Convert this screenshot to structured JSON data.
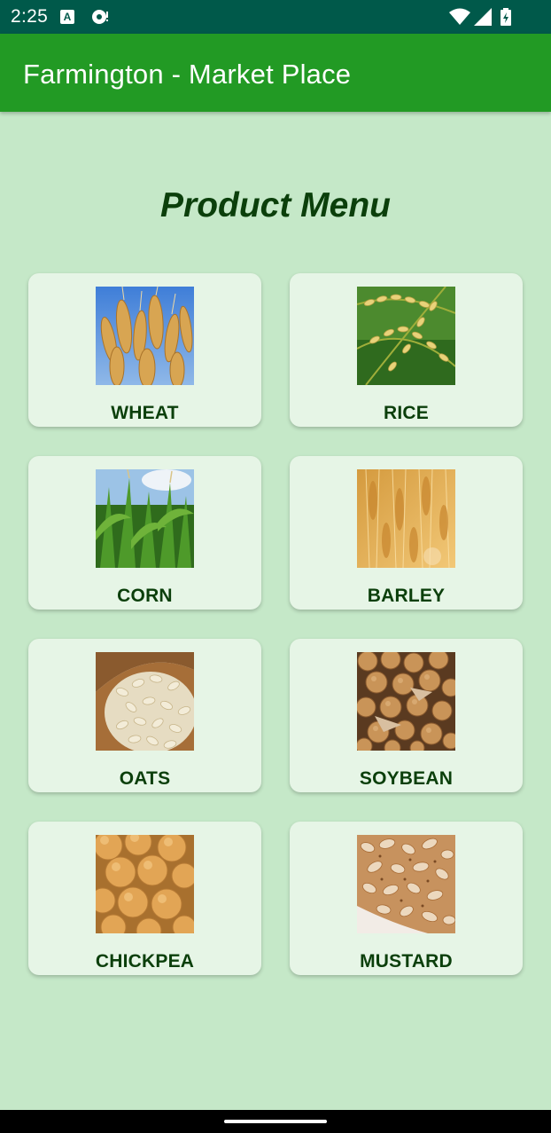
{
  "status_bar": {
    "time": "2:25",
    "icons": [
      "a-notification-icon",
      "cast-icon",
      "wifi-icon",
      "signal-icon",
      "battery-icon"
    ]
  },
  "app_bar": {
    "title": "Farmington - Market Place",
    "color": "#229a24"
  },
  "page": {
    "title": "Product Menu",
    "background": "#c5e8c8"
  },
  "products": [
    {
      "label": "WHEAT",
      "image": "wheat-image"
    },
    {
      "label": "RICE",
      "image": "rice-image"
    },
    {
      "label": "CORN",
      "image": "corn-image"
    },
    {
      "label": "BARLEY",
      "image": "barley-image"
    },
    {
      "label": "OATS",
      "image": "oats-image"
    },
    {
      "label": "SOYBEAN",
      "image": "soybean-image"
    },
    {
      "label": "CHICKPEA",
      "image": "chickpea-image"
    },
    {
      "label": "MUSTARD",
      "image": "mustard-image"
    }
  ]
}
